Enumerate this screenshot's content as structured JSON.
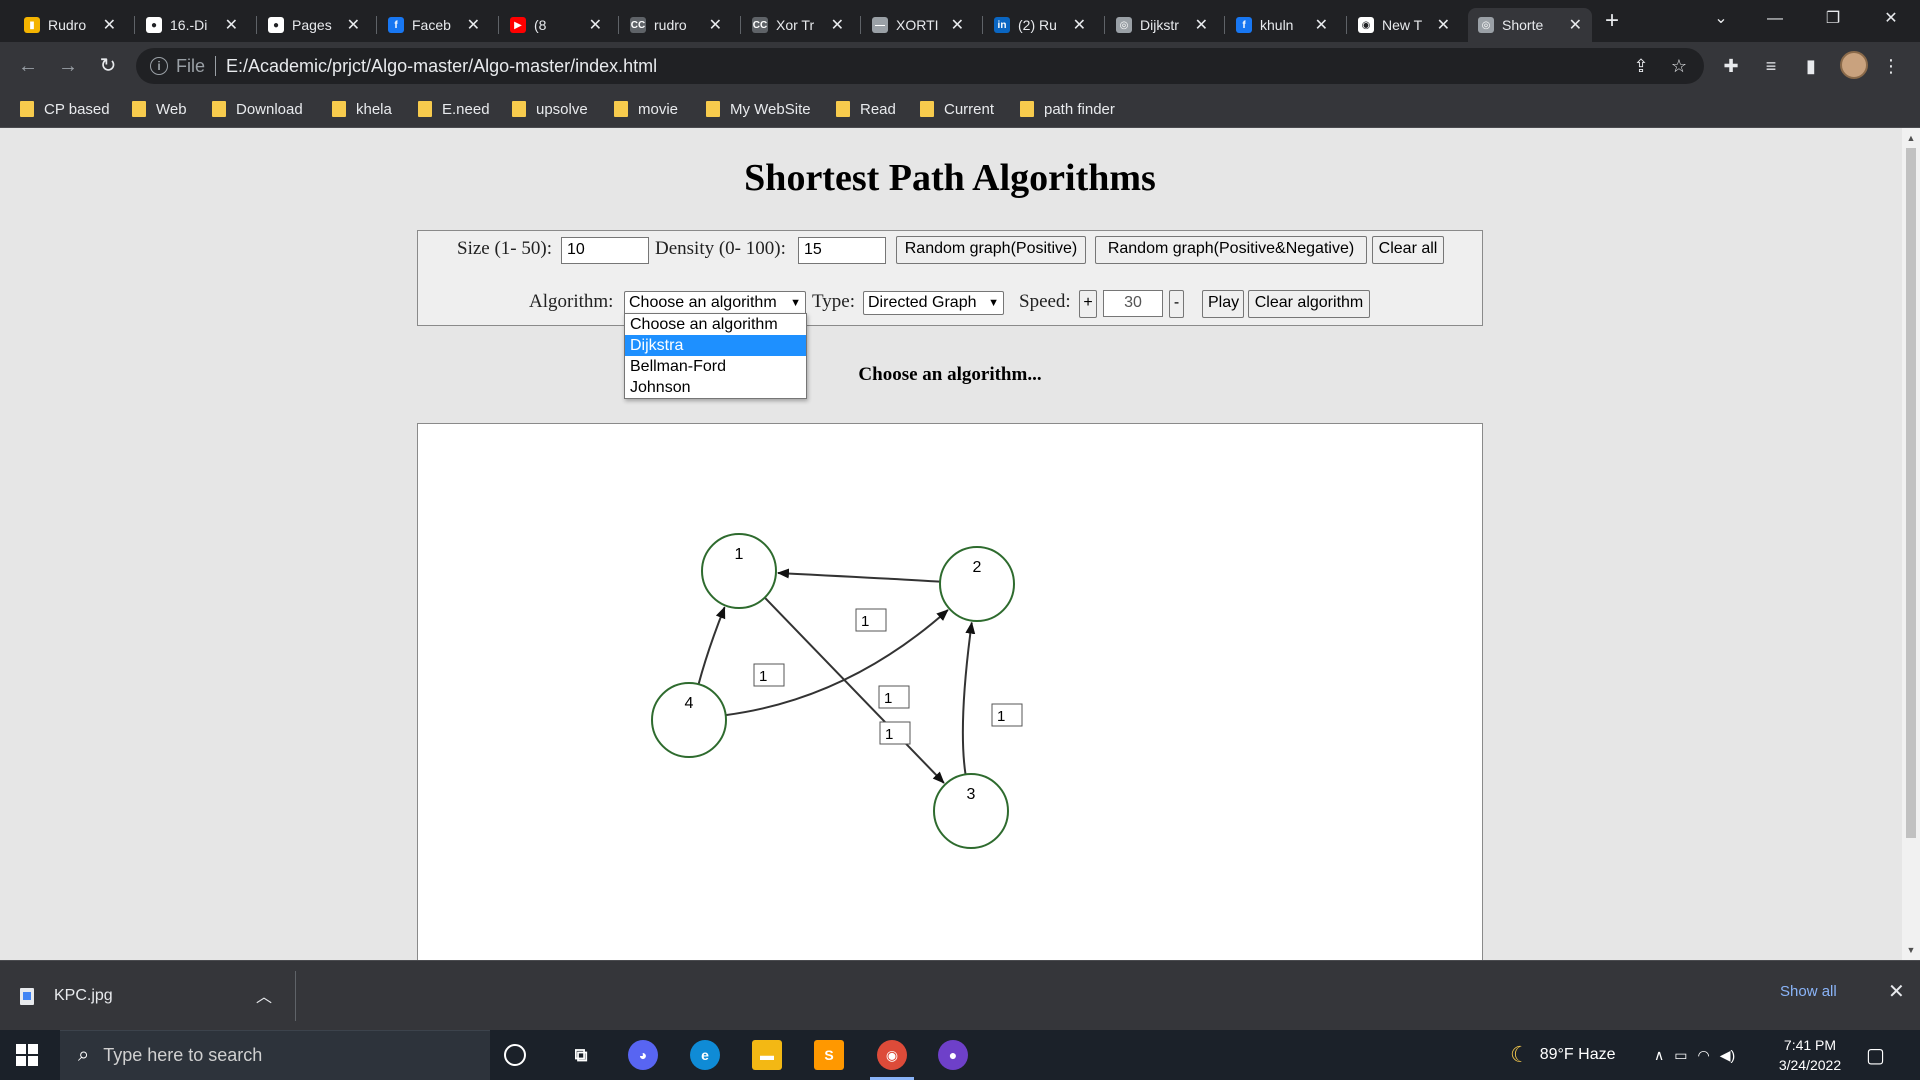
{
  "browser": {
    "tabs": [
      {
        "title": "Rudro",
        "favicon_color": "#f4b400",
        "favicon_glyph": "▮"
      },
      {
        "title": "16.-Di",
        "favicon_color": "#ffffff",
        "favicon_glyph": "●"
      },
      {
        "title": "Pages",
        "favicon_color": "#ffffff",
        "favicon_glyph": "●"
      },
      {
        "title": "Faceb",
        "favicon_color": "#1877f2",
        "favicon_glyph": "f"
      },
      {
        "title": "(8",
        "favicon_color": "#ff0000",
        "favicon_glyph": "▶"
      },
      {
        "title": "rudro",
        "favicon_color": "#5f6368",
        "favicon_glyph": "CC"
      },
      {
        "title": "Xor Tr",
        "favicon_color": "#5f6368",
        "favicon_glyph": "CC"
      },
      {
        "title": "XORTI",
        "favicon_color": "#9aa0a6",
        "favicon_glyph": "—"
      },
      {
        "title": "(2) Ru",
        "favicon_color": "#0a66c2",
        "favicon_glyph": "in"
      },
      {
        "title": "Dijkstr",
        "favicon_color": "#9aa0a6",
        "favicon_glyph": "◎"
      },
      {
        "title": "khuln",
        "favicon_color": "#1877f2",
        "favicon_glyph": "f"
      },
      {
        "title": "New T",
        "favicon_color": "#ffffff",
        "favicon_glyph": "◉"
      },
      {
        "title": "Shorte",
        "favicon_color": "#9aa0a6",
        "favicon_glyph": "◎"
      }
    ],
    "url_scheme": "File",
    "url": "E:/Academic/prjct/Algo-master/Algo-master/index.html",
    "bookmarks": [
      "CP based",
      "Web",
      "Download",
      "khela",
      "E.need",
      "upsolve",
      "movie",
      "My WebSite",
      "Read",
      "Current",
      "path finder"
    ]
  },
  "page": {
    "title": "Shortest Path Algorithms",
    "size_label": "Size (1- 50):",
    "size_value": "10",
    "density_label": "Density (0- 100):",
    "density_value": "15",
    "random_positive_label": "Random graph(Positive)",
    "random_pos_neg_label": "Random graph(Positive&Negative)",
    "clear_all_label": "Clear all",
    "algorithm_label": "Algorithm:",
    "algorithm_selected": "Choose an algorithm",
    "algorithm_options": [
      "Choose an algorithm",
      "Dijkstra",
      "Bellman-Ford",
      "Johnson"
    ],
    "algorithm_highlighted": "Dijkstra",
    "type_label": "Type:",
    "type_selected": "Directed Graph",
    "speed_label": "Speed:",
    "speed_plus": "+",
    "speed_value": "30",
    "speed_minus": "-",
    "play_label": "Play",
    "clear_algorithm_label": "Clear algorithm",
    "status": "Choose an algorithm..."
  },
  "graph": {
    "nodes": [
      {
        "id": "1",
        "label": "1"
      },
      {
        "id": "2",
        "label": "2"
      },
      {
        "id": "3",
        "label": "3"
      },
      {
        "id": "4",
        "label": "4"
      }
    ],
    "edges": [
      {
        "from": "2",
        "to": "1",
        "weight": "1"
      },
      {
        "from": "4",
        "to": "1",
        "weight": "1"
      },
      {
        "from": "4",
        "to": "2",
        "weight": "1"
      },
      {
        "from": "1",
        "to": "3",
        "weight": "1"
      },
      {
        "from": "3",
        "to": "2",
        "weight": "1"
      }
    ],
    "node_stroke": "#2e6b2e",
    "edge_color": "#333333"
  },
  "downloads": {
    "file": "KPC.jpg",
    "show_all": "Show all"
  },
  "taskbar": {
    "search_placeholder": "Type here to search",
    "weather": "89°F Haze",
    "time": "7:41 PM",
    "date": "3/24/2022"
  }
}
